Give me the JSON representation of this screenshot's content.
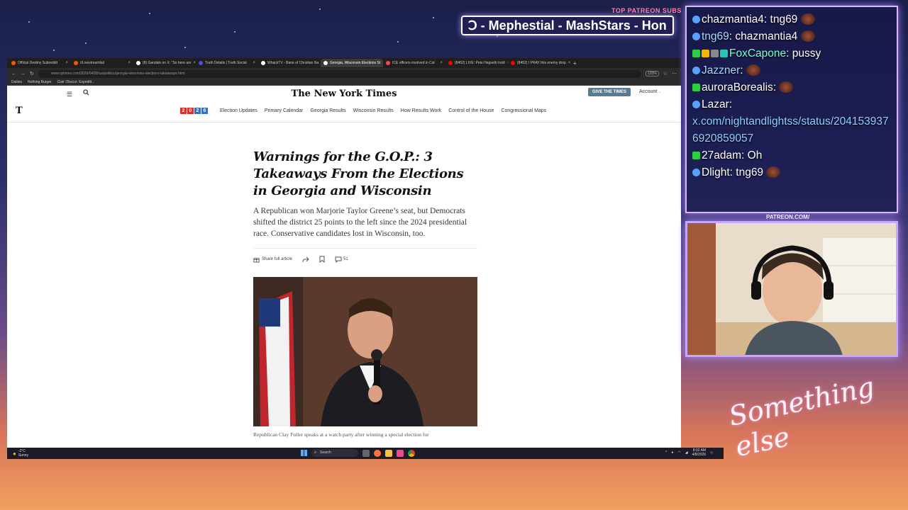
{
  "overlay": {
    "patreon_label": "TOP PATREON SUBS",
    "ticker_text": "Ↄ - Mephestial - MashStars - Hon",
    "cam_label": "PATREON.COM/",
    "signature": "Something else"
  },
  "browser": {
    "tabs": [
      {
        "title": "Official Destiny Subreddit",
        "color": "#ff5700"
      },
      {
        "title": "r/Livestreamfail",
        "color": "#ff5700"
      },
      {
        "title": "(8) Gandalv on X: \"So here are",
        "color": "#ffffff"
      },
      {
        "title": "Truth Details | Truth Social",
        "color": "#5448ee"
      },
      {
        "title": "WhackTV - Bane of Christian Na",
        "color": "#ffffff"
      },
      {
        "title": "Georgia, Wisconsin Elections St",
        "color": "#ffffff"
      },
      {
        "title": "ICE officers involved in Cal",
        "color": "#ff4444"
      },
      {
        "title": "(8452) LIVE: Pete Hegseth hold",
        "color": "#ff0000"
      },
      {
        "title": "(8452) I PRAY this enemy drop",
        "color": "#ff0000"
      }
    ],
    "active_tab_index": 5,
    "url": "www.nytimes.com/2026/04/05/us/politics/georgia-wisconsin-elections-takeaways.html",
    "zoom": "133%",
    "bookmarks": [
      "Dailies",
      "Nothing Burger",
      "Clair Obscur: Expediti..."
    ]
  },
  "nyt": {
    "masthead": "The New York Times",
    "give_button": "GIVE THE TIMES",
    "account_label": "Account",
    "t_logo": "T",
    "year_digits": [
      "2",
      "0",
      "2",
      "6"
    ],
    "nav_links": [
      "Election Updates",
      "Primary Calendar",
      "Georgia Results",
      "Wisconsin Results",
      "How Results Work",
      "Control of the House",
      "Congressional Maps"
    ],
    "headline": "Warnings for the G.O.P.: 3 Takeaways From the Elections in Georgia and Wisconsin",
    "summary": "A Republican won Marjorie Taylor Greene’s seat, but Democrats shifted the district 25 points to the left since the 2024 presidential race. Conservative candidates lost in Wisconsin, too.",
    "share_full_label": "Share full article",
    "comment_count": "51",
    "caption": "Republican Clay Fuller speaks at a watch party after winning a special election for"
  },
  "taskbar": {
    "temperature": "-2°C",
    "weather": "Sunny",
    "search_placeholder": "Search",
    "time": "8:02 AM",
    "date": "4/8/2026"
  },
  "chat": {
    "messages": [
      {
        "user": "chazmantia4",
        "text": "tng69",
        "user_color": "#ffffff",
        "badges": [
          "blue"
        ],
        "emote": true
      },
      {
        "user": "tng69",
        "text": "chazmantia4",
        "user_color": "#a8d8ff",
        "badges": [
          "blue"
        ],
        "emote": true
      },
      {
        "user": "FoxCapone",
        "text": "pussy",
        "user_color": "#7fffd0",
        "badges": [
          "green",
          "gold",
          "grey",
          "teal"
        ],
        "emote": false
      },
      {
        "user": "Jazzner",
        "text": "",
        "user_color": "#a8d8ff",
        "badges": [
          "blue"
        ],
        "emote": true
      },
      {
        "user": "auroraBorealis",
        "text": "",
        "user_color": "#ffffff",
        "badges": [
          "green"
        ],
        "emote": true
      },
      {
        "user": "Lazar",
        "text": "",
        "user_color": "#ffffff",
        "badges": [
          "blue"
        ],
        "emote": false
      },
      {
        "user": "",
        "text": "x.com/nightandlightss/status/2041539376920859057",
        "user_color": "#8fd0ff",
        "badges": [],
        "emote": false
      },
      {
        "user": "27adam",
        "text": "Oh",
        "user_color": "#ffffff",
        "badges": [
          "green"
        ],
        "emote": false
      },
      {
        "user": "Dlight",
        "text": "tng69",
        "user_color": "#ffffff",
        "badges": [
          "blue"
        ],
        "emote": true
      }
    ]
  }
}
